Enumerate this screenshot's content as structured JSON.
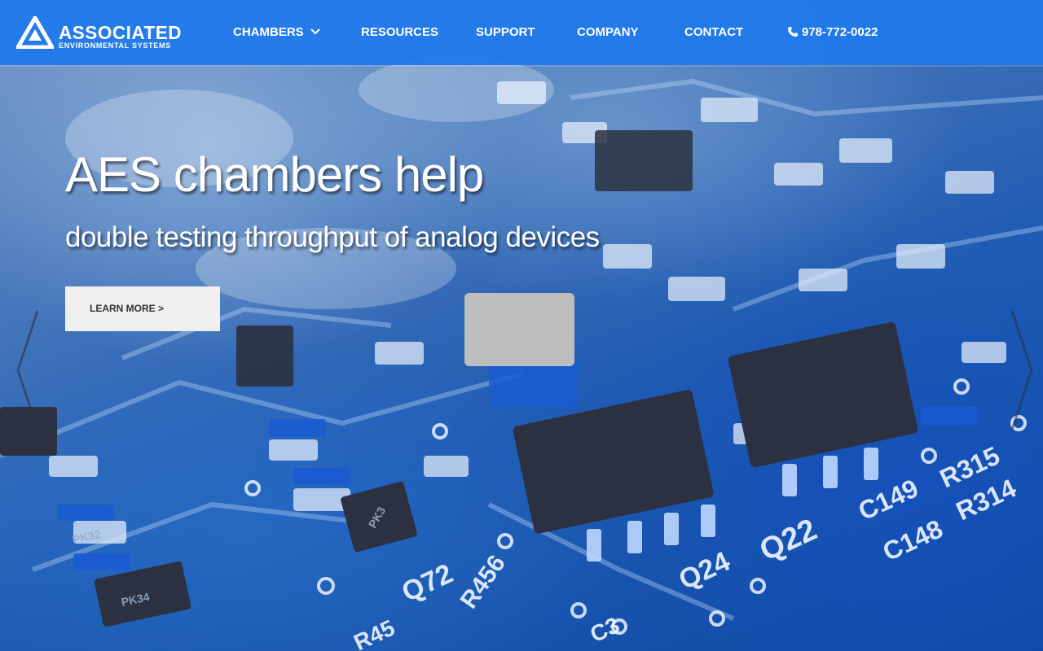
{
  "brand": {
    "name": "ASSOCIATED",
    "tagline": "ENVIRONMENTAL SYSTEMS"
  },
  "nav": {
    "items": [
      {
        "label": "CHAMBERS",
        "has_dropdown": true
      },
      {
        "label": "RESOURCES"
      },
      {
        "label": "SUPPORT"
      },
      {
        "label": "COMPANY"
      },
      {
        "label": "CONTACT"
      }
    ],
    "phone": "978-772-0022"
  },
  "hero": {
    "title": "AES chambers help",
    "subtitle": "double testing throughput of analog devices",
    "cta_label": "LEARN MORE >",
    "board_labels": [
      "R456",
      "R315",
      "R314",
      "C149",
      "C148",
      "Q22",
      "Q24",
      "Q72",
      "R45",
      "C3",
      "PK3",
      "PK34",
      "PK32"
    ]
  },
  "colors": {
    "header_bg": "#1e78eb",
    "cta_bg": "#efefef",
    "cta_text": "#333333",
    "text": "#ffffff"
  }
}
